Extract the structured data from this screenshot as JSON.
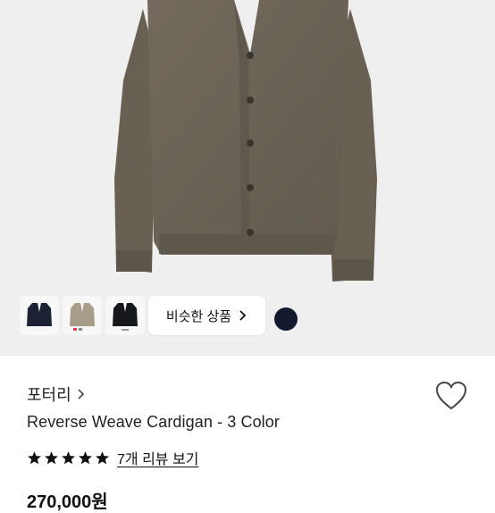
{
  "gallery": {
    "thumbnails": [
      {
        "name": "navy cardigan",
        "color": "#1c2233"
      },
      {
        "name": "beige cardigan",
        "color": "#a89d88"
      },
      {
        "name": "black cardigan",
        "color": "#16181c"
      }
    ],
    "similar_label": "비슷한 상품",
    "similar_icon": "chevron-right-icon",
    "selected_color": "#14192e"
  },
  "product": {
    "brand": "포터리",
    "brand_icon": "chevron-right-icon",
    "title": "Reverse Weave Cardigan - 3 Color",
    "rating_stars": 5,
    "review_label": "7개 리뷰 보기",
    "price_partial": "270,000원"
  },
  "colors": {
    "cardigan": "#6e6558",
    "hero_bg": "#efefef",
    "accent": "#111111"
  }
}
